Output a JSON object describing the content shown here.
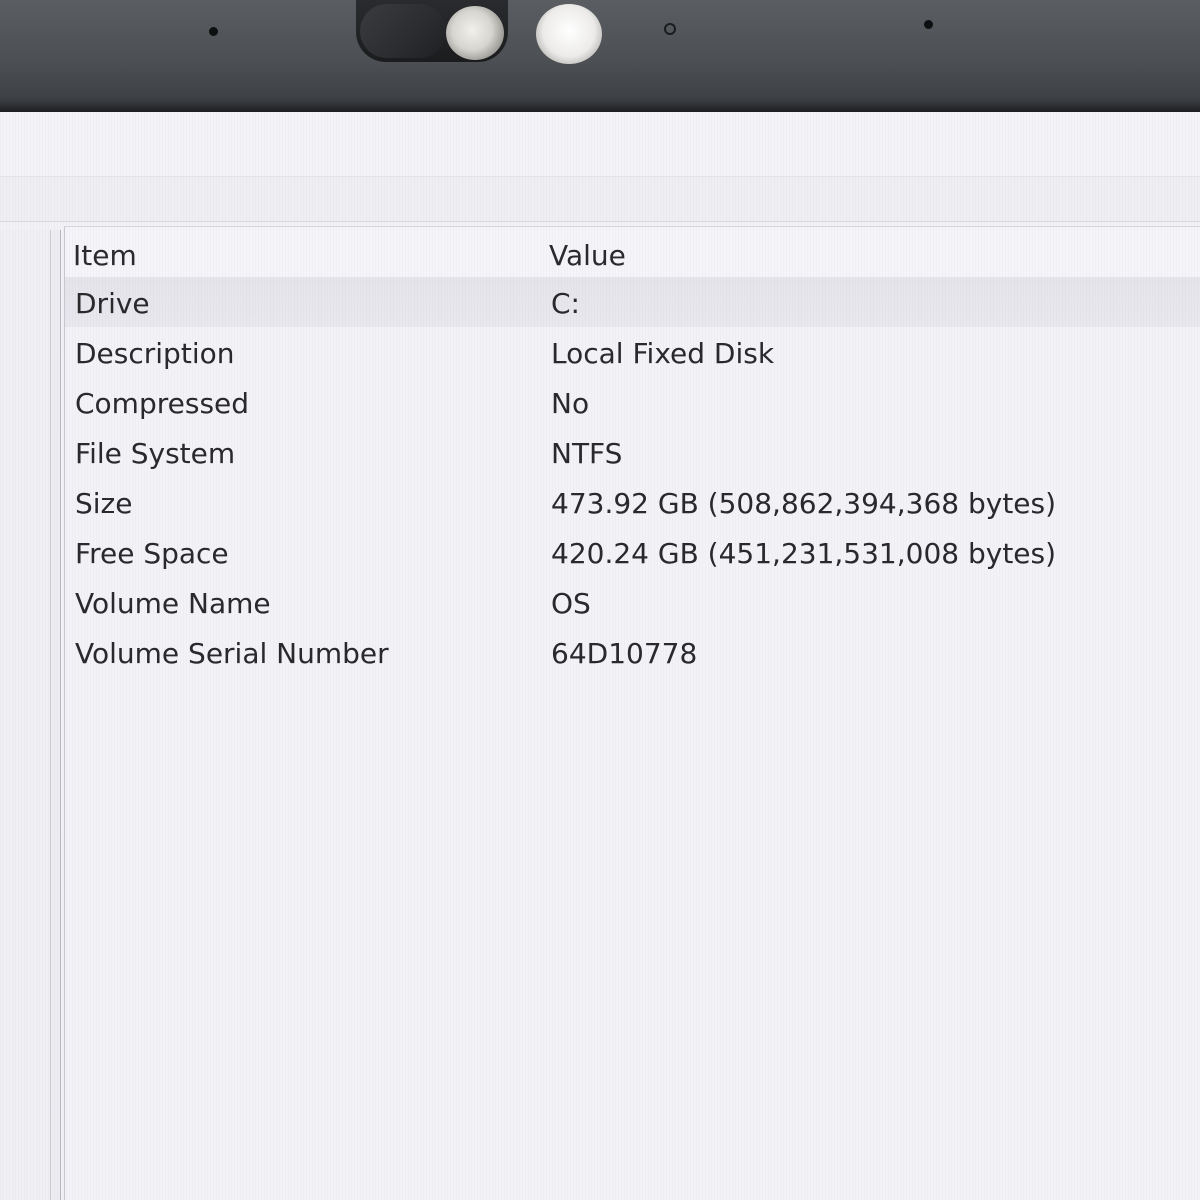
{
  "list": {
    "columns": {
      "item": "Item",
      "value": "Value"
    },
    "rows": [
      {
        "item": "Drive",
        "value": "C:"
      },
      {
        "item": "Description",
        "value": "Local Fixed Disk"
      },
      {
        "item": "Compressed",
        "value": "No"
      },
      {
        "item": "File System",
        "value": "NTFS"
      },
      {
        "item": "Size",
        "value": "473.92 GB (508,862,394,368 bytes)"
      },
      {
        "item": "Free Space",
        "value": "420.24 GB (451,231,531,008 bytes)"
      },
      {
        "item": "Volume Name",
        "value": "OS"
      },
      {
        "item": "Volume Serial Number",
        "value": "64D10778"
      }
    ],
    "selected_row": "Drive"
  },
  "colors": {
    "screen_background": "#f3f3f7",
    "text": "#2a2a2d",
    "bezel": "#4c4f53"
  },
  "icons": [
    "webcam-icon",
    "privacy-shutter-icon",
    "ir-sensor-icon"
  ]
}
